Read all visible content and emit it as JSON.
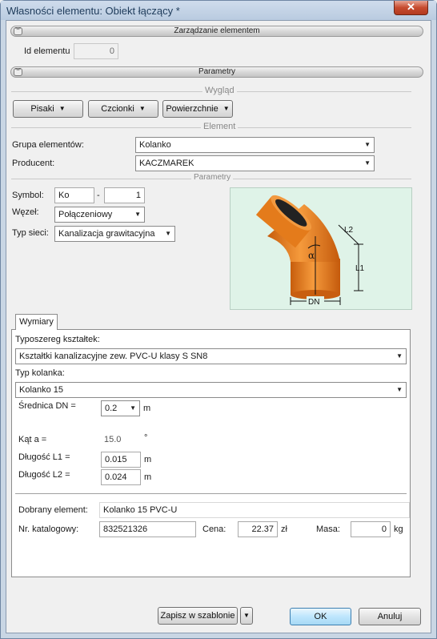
{
  "window": {
    "title": "Własności elementu: Obiekt łączący *",
    "close_label": "✕"
  },
  "sections": {
    "management": "Zarządzanie elementem",
    "params": "Parametry"
  },
  "element_id": {
    "label": "Id elementu",
    "value": "0"
  },
  "appearance": {
    "title": "Wygląd",
    "pens": "Pisaki",
    "fonts": "Czcionki",
    "surfaces": "Powierzchnie"
  },
  "element": {
    "title": "Element",
    "group_label": "Grupa elementów:",
    "group_value": "Kolanko",
    "producer_label": "Producent:",
    "producer_value": "KACZMAREK"
  },
  "parameters": {
    "title": "Parametry",
    "symbol_label": "Symbol:",
    "symbol_prefix": "Ko",
    "symbol_sep": "-",
    "symbol_number": "1",
    "node_label": "Węzeł:",
    "node_value": "Połączeniowy",
    "network_label": "Typ sieci:",
    "network_value": "Kanalizacja grawitacyjna"
  },
  "diagram": {
    "alpha": "α",
    "l1": "L1",
    "l2": "L2",
    "dn": "DN",
    "pipe_color": "#e0781a"
  },
  "tabs": {
    "dimensions": "Wymiary"
  },
  "dimensions": {
    "series_label": "Typoszereg kształtek:",
    "series_value": "Kształtki kanalizacyjne zew. PVC-U klasy S SN8",
    "elbow_type_label": "Typ kolanka:",
    "elbow_type_value": "Kolanko 15",
    "dn_label": "Średnica DN =",
    "dn_value": "0.2",
    "dn_unit": "m",
    "angle_label": "Kąt a =",
    "angle_value": "15.0",
    "angle_unit": "°",
    "l1_label": "Długość L1 =",
    "l1_value": "0.015",
    "l1_unit": "m",
    "l2_label": "Długość L2 =",
    "l2_value": "0.024",
    "l2_unit": "m"
  },
  "result": {
    "chosen_label": "Dobrany element:",
    "chosen_value": "Kolanko 15 PVC-U",
    "catalog_label": "Nr. katalogowy:",
    "catalog_value": "832521326",
    "price_label": "Cena:",
    "price_value": "22.37",
    "price_unit": "zł",
    "mass_label": "Masa:",
    "mass_value": "0",
    "mass_unit": "kg"
  },
  "footer": {
    "save_template": "Zapisz w szablonie",
    "ok": "OK",
    "cancel": "Anuluj"
  }
}
